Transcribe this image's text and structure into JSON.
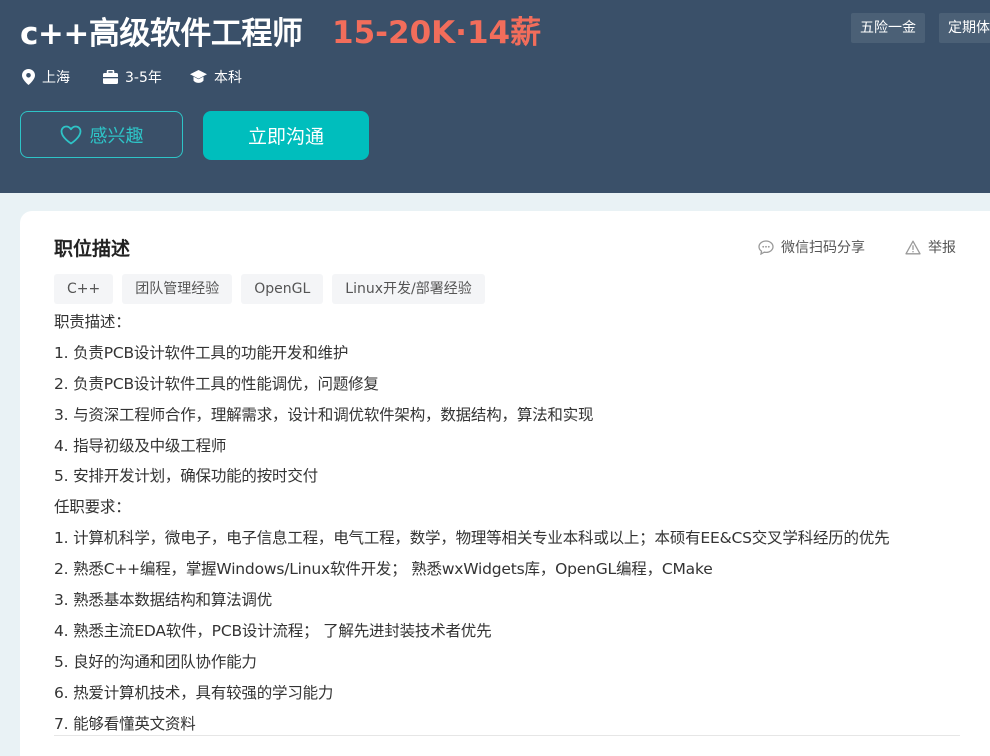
{
  "job": {
    "title": "c++高级软件工程师",
    "salary": "15-20K·14薪",
    "welfare": [
      "五险一金",
      "定期体"
    ],
    "location": "上海",
    "experience": "3-5年",
    "degree": "本科"
  },
  "actions": {
    "interest_label": "感兴趣",
    "chat_label": "立即沟通"
  },
  "section": {
    "title": "职位描述",
    "share_label": "微信扫码分享",
    "report_label": "举报"
  },
  "tags": [
    "C++",
    "团队管理经验",
    "OpenGL",
    "Linux开发/部署经验"
  ],
  "description": [
    "职责描述：",
    "1. 负责PCB设计软件工具的功能开发和维护",
    "2. 负责PCB设计软件工具的性能调优，问题修复",
    "3. 与资深工程师合作，理解需求，设计和调优软件架构，数据结构，算法和实现",
    "4. 指导初级及中级工程师",
    "5. 安排开发计划，确保功能的按时交付",
    "任职要求：",
    "1. 计算机科学，微电子，电子信息工程，电气工程，数学，物理等相关专业本科或以上；本硕有EE&CS交叉学科经历的优先",
    "2. 熟悉C++编程，掌握Windows/Linux软件开发； 熟悉wxWidgets库，OpenGL编程，CMake",
    "3. 熟悉基本数据结构和算法调优",
    "4. 熟悉主流EDA软件，PCB设计流程； 了解先进封装技术者优先",
    "5. 良好的沟通和团队协作能力",
    "6. 热爱计算机技术，具有较强的学习能力",
    "7. 能够看懂英文资料"
  ],
  "colors": {
    "header_bg": "#3a5069",
    "salary": "#f26d5b",
    "accent": "#00bebd"
  }
}
